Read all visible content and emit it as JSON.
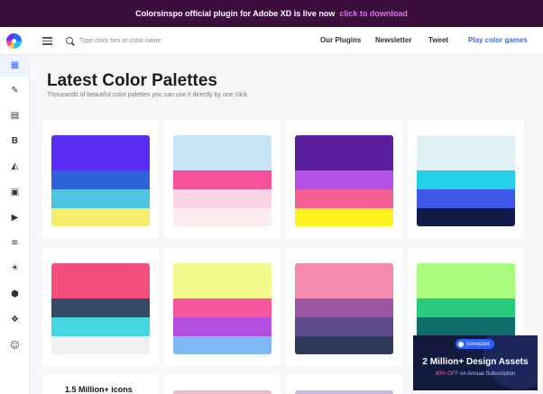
{
  "banner": {
    "text": "Colorsinspo official plugin for Adobe XD is live now",
    "link": "click to download"
  },
  "header": {
    "search_placeholder": "Type color hex or color name",
    "nav": [
      "Our Plugins",
      "Newsletter",
      "Tweet",
      "Play color games"
    ],
    "accent_color": "#3b6bff"
  },
  "sidebar": {
    "items": [
      {
        "icon": "grid-icon",
        "glyph": "▦",
        "active": true
      },
      {
        "icon": "pen-icon",
        "glyph": "✎"
      },
      {
        "icon": "gradient-icon",
        "glyph": "▤"
      },
      {
        "icon": "bold-b-icon",
        "glyph": "B"
      },
      {
        "icon": "paint-bucket-icon",
        "glyph": "◭"
      },
      {
        "icon": "news-icon",
        "glyph": "▣"
      },
      {
        "icon": "video-icon",
        "glyph": "▶"
      },
      {
        "icon": "layers-icon",
        "glyph": "≡"
      },
      {
        "icon": "sun-icon",
        "glyph": "☀"
      },
      {
        "icon": "cube-icon",
        "glyph": "⬢"
      },
      {
        "icon": "gift-icon",
        "glyph": "❖"
      },
      {
        "icon": "user-icon",
        "glyph": "☺"
      }
    ]
  },
  "main": {
    "title": "Latest Color Palettes",
    "subtitle": "Thousands of beautiful color palettes you can use it directly by one click."
  },
  "palettes": [
    [
      "#5b2cf6",
      "#2f62d9",
      "#4dc4e0",
      "#f5ee6a"
    ],
    [
      "#c8e3f5",
      "#f6509a",
      "#fbd3e3",
      "#fcecec"
    ],
    [
      "#5b1f9d",
      "#b64fe8",
      "#f35f93",
      "#fff31f"
    ],
    [
      "#dff1f4",
      "#26cfe8",
      "#4058e6",
      "#121a4a"
    ],
    [
      "#f24f7e",
      "#344a68",
      "#46d6e0",
      "#f0f0f0"
    ],
    [
      "#f1f98d",
      "#f6569e",
      "#b24ee0",
      "#7eb8f6"
    ],
    [
      "#f48aad",
      "#9d56a3",
      "#5d4a8d",
      "#2f3a58"
    ],
    [
      "#a8fb7c",
      "#27c97d",
      "#0f6d6a",
      "#111a3a"
    ]
  ],
  "partials": [
    "#ee9bbf",
    "#f2b9cc",
    "#c9b8e0"
  ],
  "promo": {
    "text": "1.5 Million+ icons"
  },
  "ad": {
    "brand": "iconscout",
    "headline": "2 Million+ Design Assets",
    "discount": "80% OFF",
    "sub": "on Annual Subscription"
  }
}
